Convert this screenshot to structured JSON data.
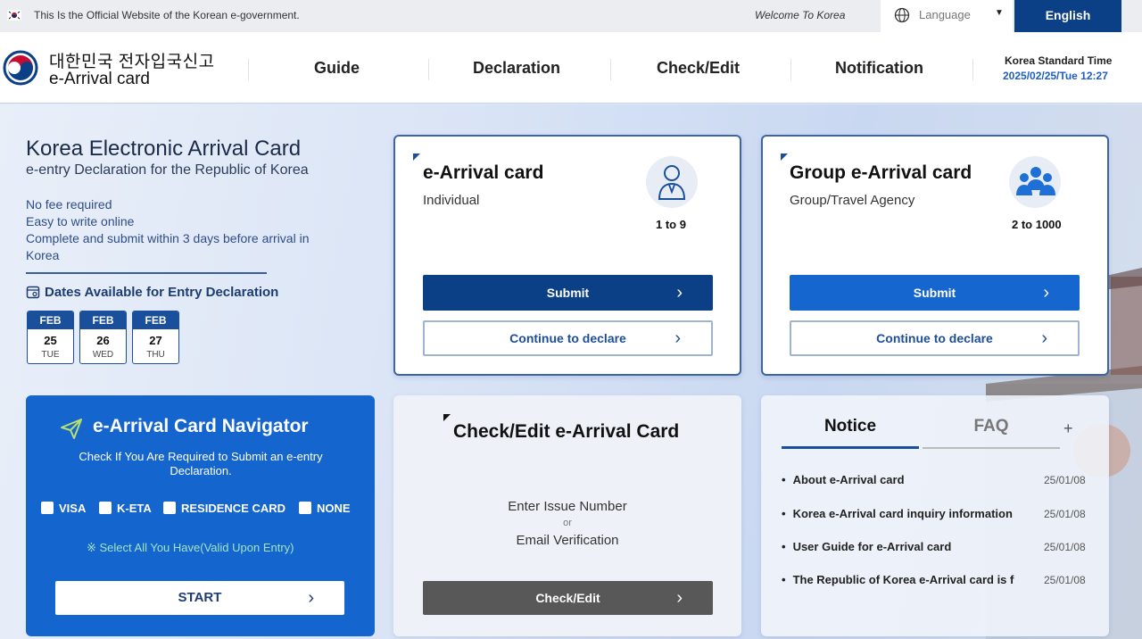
{
  "top_bar": {
    "gov_notice": "This Is the Official Website of the Korean e-government.",
    "welcome": "Welcome To Korea",
    "language_label": "Language",
    "english_button": "English"
  },
  "header": {
    "logo_korean": "대한민국 전자입국신고",
    "logo_english": "e-Arrival card",
    "nav": [
      "Guide",
      "Declaration",
      "Check/Edit",
      "Notification"
    ],
    "time_label": "Korea Standard Time",
    "time_value": "2025/02/25/Tue 12:27"
  },
  "intro": {
    "title": "Korea Electronic Arrival Card",
    "subtitle": "e-entry Declaration for the Republic of Korea",
    "features": [
      "No fee required",
      "Easy to write online",
      "Complete and submit within 3 days before arrival in",
      "Korea"
    ],
    "dates_label": "Dates Available for Entry Declaration",
    "dates": [
      {
        "month": "FEB",
        "day": "25",
        "dow": "TUE"
      },
      {
        "month": "FEB",
        "day": "26",
        "dow": "WED"
      },
      {
        "month": "FEB",
        "day": "27",
        "dow": "THU"
      }
    ]
  },
  "individual_card": {
    "title": "e-Arrival card",
    "subtitle": "Individual",
    "count": "1 to 9",
    "submit": "Submit",
    "continue": "Continue to declare"
  },
  "group_card": {
    "title": "Group e-Arrival card",
    "subtitle": "Group/Travel Agency",
    "count": "2 to 1000",
    "submit": "Submit",
    "continue": "Continue to declare"
  },
  "navigator": {
    "title": "e-Arrival Card Navigator",
    "description": "Check If You Are Required to Submit an e-entry Declaration.",
    "options": [
      "VISA",
      "K-ETA",
      "RESIDENCE CARD",
      "NONE"
    ],
    "note": "※ Select All You Have(Valid Upon Entry)",
    "start": "START"
  },
  "check_edit": {
    "title": "Check/Edit e-Arrival Card",
    "line1": "Enter Issue Number",
    "or": "or",
    "line2": "Email Verification",
    "button": "Check/Edit"
  },
  "notice_panel": {
    "tab_notice": "Notice",
    "tab_faq": "FAQ",
    "plus": "+",
    "items": [
      {
        "title": "About e-Arrival card",
        "date": "25/01/08"
      },
      {
        "title": "Korea e-Arrival card inquiry information",
        "date": "25/01/08"
      },
      {
        "title": "User Guide for e-Arrival card",
        "date": "25/01/08"
      },
      {
        "title": "The Republic of Korea e-Arrival card is f",
        "date": "25/01/08"
      }
    ]
  },
  "colors": {
    "brand_navy": "#0b3f86",
    "brand_blue": "#1565cf",
    "check_edit_gray": "#585858"
  }
}
